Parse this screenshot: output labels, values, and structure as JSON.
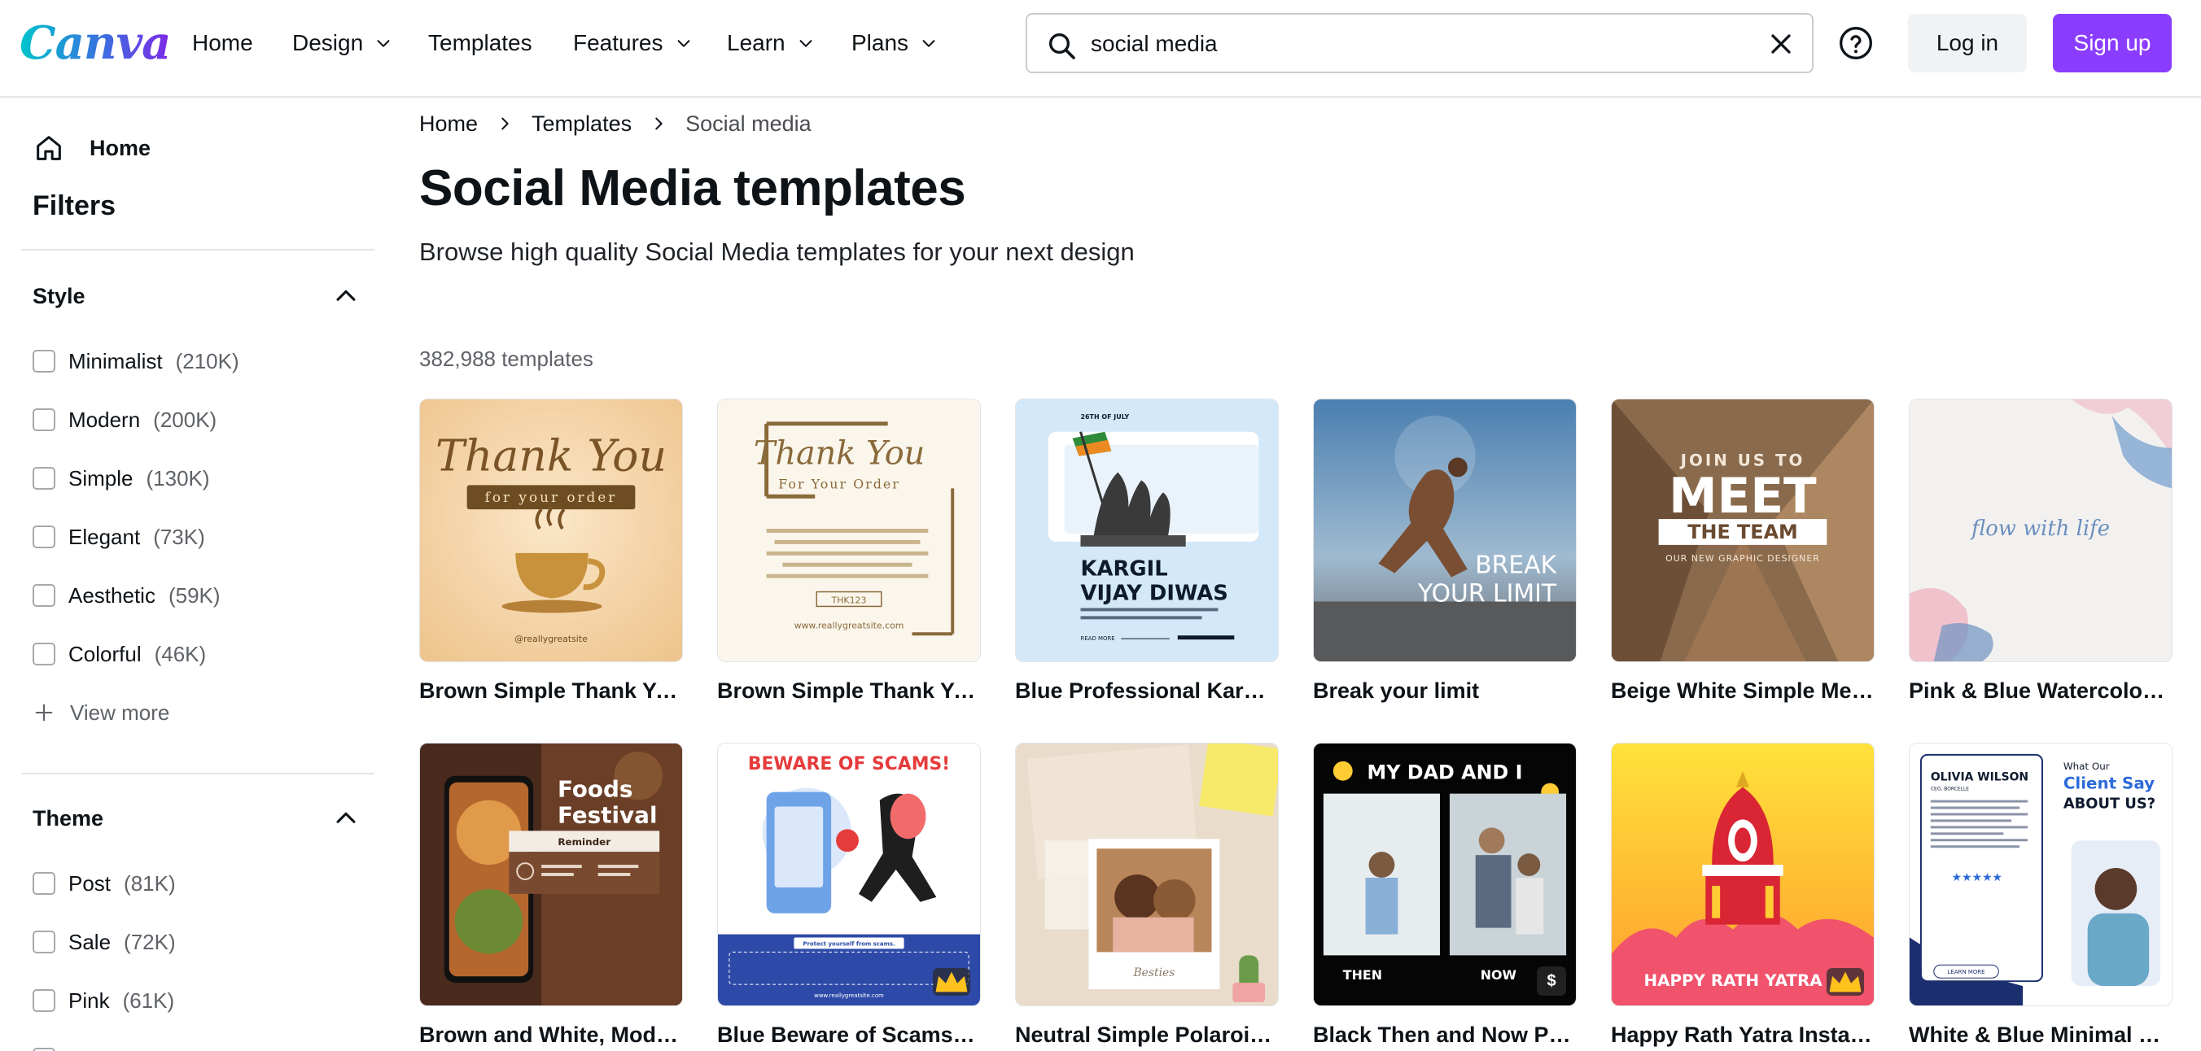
{
  "header": {
    "logo": "Canva",
    "nav": [
      "Home",
      "Design",
      "Templates",
      "Features",
      "Learn",
      "Plans"
    ],
    "search_value": "social media",
    "login_label": "Log in",
    "signup_label": "Sign up"
  },
  "sidebar": {
    "home_label": "Home",
    "filters_title": "Filters",
    "style": {
      "title": "Style",
      "items": [
        {
          "label": "Minimalist",
          "count": "(210K)"
        },
        {
          "label": "Modern",
          "count": "(200K)"
        },
        {
          "label": "Simple",
          "count": "(130K)"
        },
        {
          "label": "Elegant",
          "count": "(73K)"
        },
        {
          "label": "Aesthetic",
          "count": "(59K)"
        },
        {
          "label": "Colorful",
          "count": "(46K)"
        }
      ],
      "view_more": "View more"
    },
    "theme": {
      "title": "Theme",
      "items": [
        {
          "label": "Post",
          "count": "(81K)"
        },
        {
          "label": "Sale",
          "count": "(72K)"
        },
        {
          "label": "Pink",
          "count": "(61K)"
        }
      ]
    }
  },
  "breadcrumb": [
    "Home",
    "Templates",
    "Social media"
  ],
  "page": {
    "title": "Social Media templates",
    "subtitle": "Browse high quality Social Media templates for your next design",
    "template_count": "382,988 templates"
  },
  "templates": [
    {
      "title": "Brown Simple Thank You...",
      "texts": [
        "Thank You",
        "for your order",
        "@reallygreatsite"
      ]
    },
    {
      "title": "Brown Simple Thank You...",
      "texts": [
        "Thank You",
        "For Your Order",
        "THK123",
        "www.reallygreatsite.com"
      ]
    },
    {
      "title": "Blue Professional Kargil ...",
      "texts": [
        "26TH OF JULY",
        "KARGIL",
        "VIJAY DIWAS",
        "READ MORE"
      ]
    },
    {
      "title": "Break your limit",
      "texts": [
        "BREAK",
        "YOUR LIMIT"
      ]
    },
    {
      "title": "Beige White Simple Mee...",
      "texts": [
        "JOIN US TO",
        "MEET",
        "THE TEAM",
        "OUR NEW GRAPHIC DESIGNER"
      ]
    },
    {
      "title": "Pink & Blue Watercolor P...",
      "texts": [
        "flow with life"
      ]
    },
    {
      "title": "Brown and White, Moder...",
      "texts": [
        "Foods",
        "Festival",
        "Reminder"
      ]
    },
    {
      "title": "Blue Beware of Scams In...",
      "texts": [
        "BEWARE OF SCAMS!",
        "Protect yourself from scams.",
        "www.reallygreatsite.com"
      ]
    },
    {
      "title": "Neutral Simple Polaroid ...",
      "texts": [
        "Besties"
      ]
    },
    {
      "title": "Black Then and Now Pho...",
      "texts": [
        "MY DAD AND I",
        "THEN",
        "NOW",
        "$"
      ]
    },
    {
      "title": "Happy Rath Yatra Instag...",
      "texts": [
        "HAPPY RATH YATRA"
      ]
    },
    {
      "title": "White & Blue Minimal Cli...",
      "texts": [
        "OLIVIA WILSON",
        "CEO, BORCELLE",
        "What Our",
        "Client Say",
        "ABOUT US?",
        "LEARN MORE"
      ]
    }
  ]
}
